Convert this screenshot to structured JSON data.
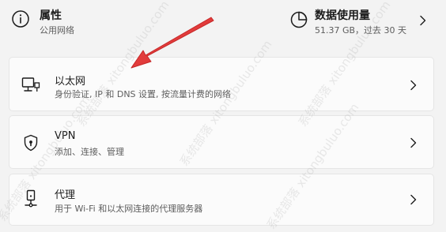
{
  "properties": {
    "title": "属性",
    "subtitle": "公用网络",
    "icon": "info-icon"
  },
  "data_usage": {
    "title": "数据使用量",
    "subtitle": "51.37 GB，过去 30 天",
    "icon": "pie-chart-icon"
  },
  "rows": [
    {
      "title": "以太网",
      "desc": "身份验证, IP 和 DNS 设置, 按流量计费的网络",
      "icon": "ethernet-monitor-icon"
    },
    {
      "title": "VPN",
      "desc": "添加、连接、管理",
      "icon": "shield-icon"
    },
    {
      "title": "代理",
      "desc": "用于 Wi-Fi 和以太网连接的代理服务器",
      "icon": "proxy-server-icon"
    }
  ],
  "watermark": {
    "text": "系统部落 xitongbuluo.com"
  },
  "colors": {
    "background": "#f3f3f3",
    "card": "#fbfbfb",
    "annotation_arrow": "#e53935"
  }
}
